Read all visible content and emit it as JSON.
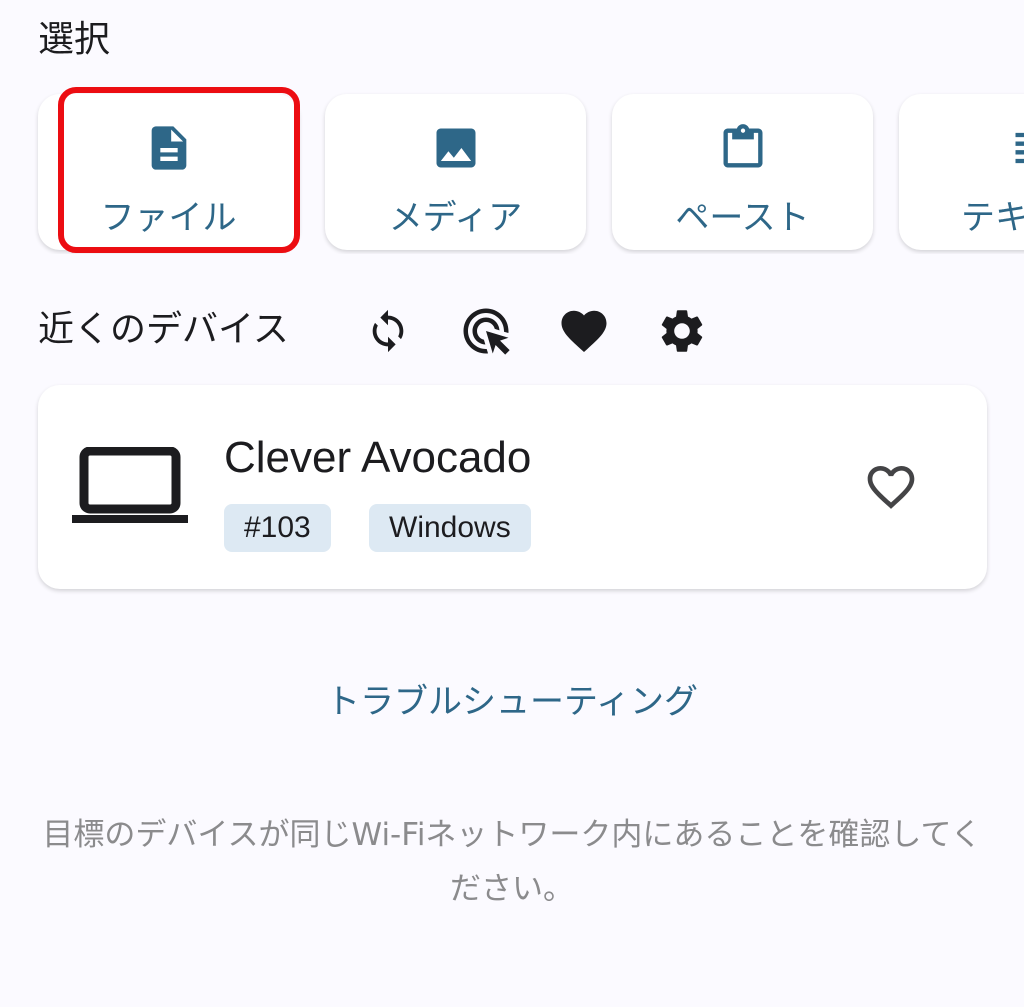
{
  "select_section": {
    "title": "選択",
    "cards": [
      {
        "label": "ファイル",
        "icon": "file-icon"
      },
      {
        "label": "メディア",
        "icon": "image-icon"
      },
      {
        "label": "ペースト",
        "icon": "clipboard-icon"
      },
      {
        "label": "テキ",
        "icon": "text-icon"
      }
    ]
  },
  "nearby_section": {
    "title": "近くのデバイス",
    "icons": [
      "refresh-icon",
      "target-cursor-icon",
      "heart-icon",
      "gear-icon"
    ]
  },
  "device": {
    "name": "Clever Avocado",
    "id_chip": "#103",
    "os_chip": "Windows",
    "icon": "laptop-icon",
    "favorite_icon": "heart-outline-icon"
  },
  "troubleshoot_label": "トラブルシューティング",
  "hint_text": "目標のデバイスが同じWi-Fiネットワーク内にあることを確認してください。",
  "colors": {
    "accent": "#2e6788",
    "background": "#fbfaff",
    "chip": "#dde9f3",
    "highlight": "#ec0d12",
    "hint": "#8b8b8d"
  }
}
